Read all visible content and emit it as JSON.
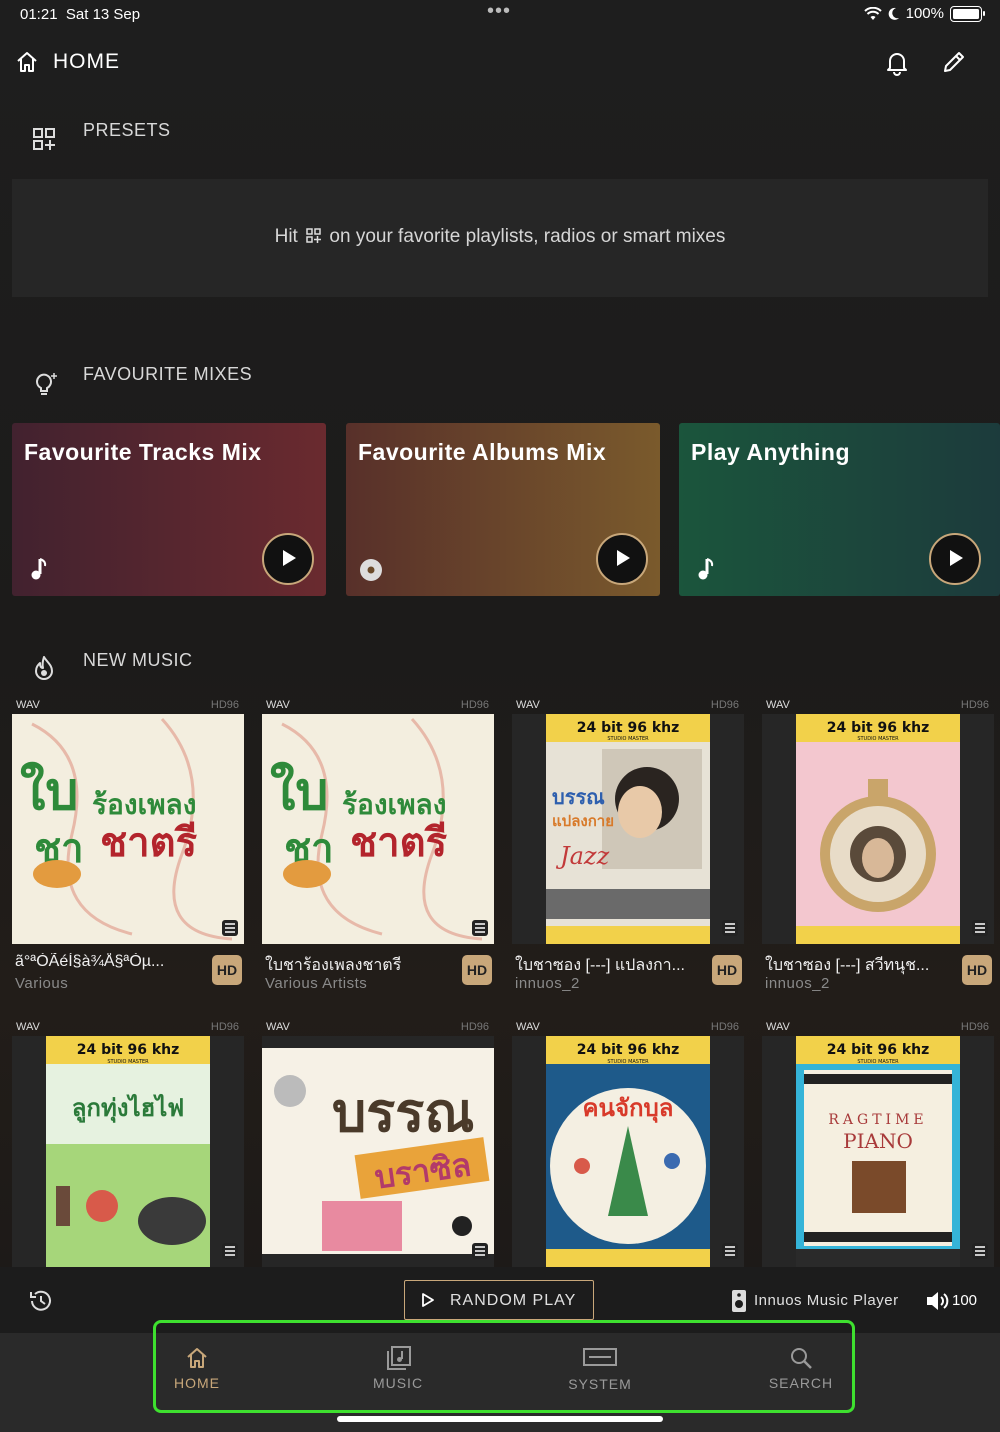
{
  "status_bar": {
    "time": "01:21",
    "date": "Sat 13 Sep",
    "battery": "100%"
  },
  "header": {
    "title": "HOME"
  },
  "presets": {
    "label": "PRESETS",
    "message_before": "Hit",
    "message_after": "on your favorite playlists, radios or smart mixes"
  },
  "favourite_mixes": {
    "label": "FAVOURITE MIXES",
    "cards": [
      {
        "title": "Favourite Tracks Mix",
        "icon": "music-note-icon",
        "colors": [
          "#4a2332",
          "#6b2a2e"
        ]
      },
      {
        "title": "Favourite Albums Mix",
        "icon": "disc-icon",
        "colors": [
          "#5a2e27",
          "#7a5a2a"
        ]
      },
      {
        "title": "Play Anything",
        "icon": "music-note-icon",
        "colors": [
          "#1c5a3e",
          "#1c3d3d"
        ]
      }
    ]
  },
  "new_music": {
    "label": "NEW MUSIC",
    "albums": [
      {
        "format": "WAV",
        "quality": "HD96",
        "title": "ã°ªÒÃéÍ§à¾Å§ªÒµ...",
        "artist": "Various",
        "badge": "HD"
      },
      {
        "format": "WAV",
        "quality": "HD96",
        "title": "ใบชาร้องเพลงชาตรี",
        "artist": "Various Artists",
        "badge": "HD"
      },
      {
        "format": "WAV",
        "quality": "HD96",
        "title": "ใบชาซอง [---] แปลงกา...",
        "artist": "innuos_2",
        "badge": "HD"
      },
      {
        "format": "WAV",
        "quality": "HD96",
        "title": "ใบชาซอง [---] สวีทนุช...",
        "artist": "innuos_2",
        "badge": "HD"
      },
      {
        "format": "WAV",
        "quality": "HD96",
        "title": "",
        "artist": "",
        "badge": ""
      },
      {
        "format": "WAV",
        "quality": "HD96",
        "title": "",
        "artist": "",
        "badge": ""
      },
      {
        "format": "WAV",
        "quality": "HD96",
        "title": "",
        "artist": "",
        "badge": ""
      },
      {
        "format": "WAV",
        "quality": "HD96",
        "title": "",
        "artist": "",
        "badge": ""
      }
    ],
    "cover_art": {
      "banner": "24 bit 96 khz",
      "banner_sub": "STUDIO MASTER",
      "art1": [
        "ใบ",
        "ชา",
        "ร้องเพลง",
        "ชาตรี"
      ],
      "art3": [
        "บรรณ",
        "แปลงกาย",
        "Jazz"
      ],
      "art5": "ลูกทุ่งไฮไฟ",
      "art6": [
        "บรรณ",
        "บราซิล"
      ],
      "art7": "คนจักบุล",
      "art8": [
        "RAGTIME",
        "PIANO"
      ]
    }
  },
  "player_bar": {
    "random_play": "RANDOM PLAY",
    "player_name": "Innuos Music Player",
    "volume": "100"
  },
  "tabs": [
    {
      "label": "HOME",
      "active": true
    },
    {
      "label": "MUSIC",
      "active": false
    },
    {
      "label": "SYSTEM",
      "active": false
    },
    {
      "label": "SEARCH",
      "active": false
    }
  ],
  "colors": {
    "accent": "#c8a77a",
    "focus": "#3ee02f"
  }
}
